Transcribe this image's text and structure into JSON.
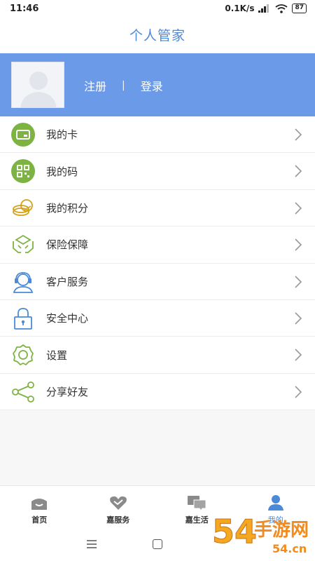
{
  "status_bar": {
    "time": "11:46",
    "speed": "0.1K/s",
    "battery": "87"
  },
  "header": {
    "title": "个人管家"
  },
  "profile": {
    "register": "注册",
    "separator": "|",
    "login": "登录"
  },
  "menu": [
    {
      "label": "我的卡",
      "icon": "card-icon"
    },
    {
      "label": "我的码",
      "icon": "qr-code-icon"
    },
    {
      "label": "我的积分",
      "icon": "coins-icon"
    },
    {
      "label": "保险保障",
      "icon": "insurance-hands-icon"
    },
    {
      "label": "客户服务",
      "icon": "headset-service-icon"
    },
    {
      "label": "安全中心",
      "icon": "lock-icon"
    },
    {
      "label": "设置",
      "icon": "gear-icon"
    },
    {
      "label": "分享好友",
      "icon": "share-icon"
    }
  ],
  "tabs": [
    {
      "label": "首页",
      "icon": "home-icon"
    },
    {
      "label": "嘉服务",
      "icon": "heart-icon"
    },
    {
      "label": "嘉生活",
      "icon": "chat-bubbles-icon"
    },
    {
      "label": "我的",
      "icon": "user-icon",
      "active": true
    }
  ],
  "watermark": {
    "text": "54手游网",
    "domain": "54.cn"
  },
  "colors": {
    "accent": "#4a8ad8",
    "profile_bg": "#6b9be8",
    "icon_green": "#7cb342",
    "icon_gold": "#d4a017"
  }
}
